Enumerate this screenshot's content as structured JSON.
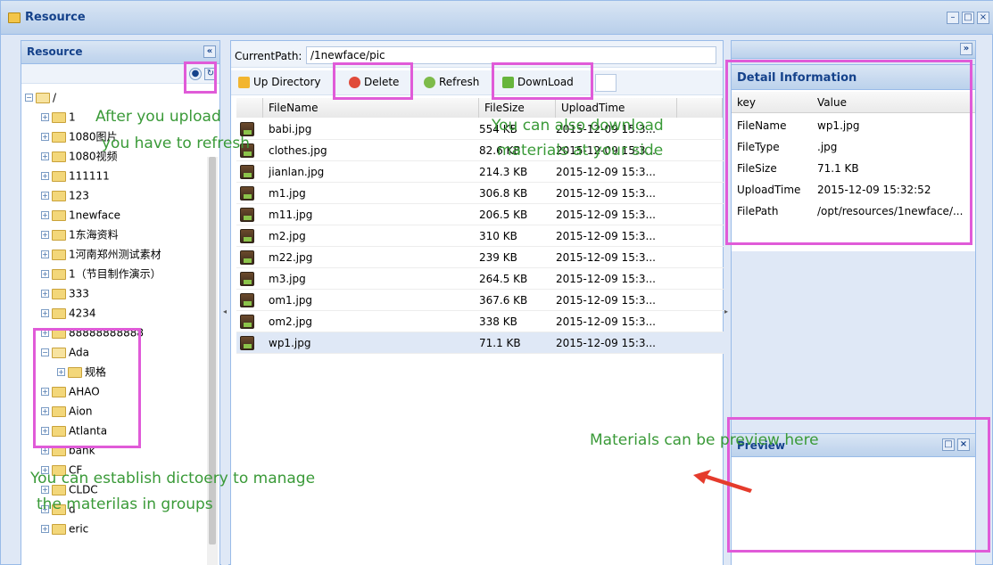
{
  "window": {
    "title": "Resource"
  },
  "left_panel": {
    "title": "Resource",
    "collapse_icon": "«",
    "tree": [
      {
        "label": "/",
        "open": true,
        "level": 0
      },
      {
        "label": "1",
        "open": false,
        "level": 1
      },
      {
        "label": "1080图片",
        "open": false,
        "level": 1
      },
      {
        "label": "1080视频",
        "open": false,
        "level": 1
      },
      {
        "label": "111111",
        "open": false,
        "level": 1
      },
      {
        "label": "123",
        "open": false,
        "level": 1
      },
      {
        "label": "1newface",
        "open": false,
        "level": 1
      },
      {
        "label": "1东海资料",
        "open": false,
        "level": 1
      },
      {
        "label": "1河南郑州测试素材",
        "open": false,
        "level": 1
      },
      {
        "label": "1（节目制作演示）",
        "open": false,
        "level": 1
      },
      {
        "label": "333",
        "open": false,
        "level": 1
      },
      {
        "label": "4234",
        "open": false,
        "level": 1
      },
      {
        "label": "88888888888",
        "open": false,
        "level": 1
      },
      {
        "label": "Ada",
        "open": true,
        "level": 1
      },
      {
        "label": "规格",
        "open": false,
        "level": 2
      },
      {
        "label": "AHAO",
        "open": false,
        "level": 1
      },
      {
        "label": "Aion",
        "open": false,
        "level": 1
      },
      {
        "label": "Atlanta",
        "open": false,
        "level": 1
      },
      {
        "label": "bank",
        "open": false,
        "level": 1
      },
      {
        "label": "CF",
        "open": false,
        "level": 1
      },
      {
        "label": "CLDC",
        "open": false,
        "level": 1
      },
      {
        "label": "d",
        "open": false,
        "level": 1
      },
      {
        "label": "eric",
        "open": false,
        "level": 1
      }
    ]
  },
  "center": {
    "path_label": "CurrentPath:",
    "path_value": "/1newface/pic",
    "toolbar": {
      "up_label": "Up Directory",
      "delete_label": "Delete",
      "refresh_label": "Refresh",
      "download_label": "DownLoad"
    },
    "columns": [
      "FileName",
      "FileSize",
      "UploadTime"
    ],
    "rows": [
      {
        "name": "babi.jpg",
        "size": "554 KB",
        "time": "2015-12-09 15:3..."
      },
      {
        "name": "clothes.jpg",
        "size": "82.6 KB",
        "time": "2015-12-09 15:3..."
      },
      {
        "name": "jianlan.jpg",
        "size": "214.3 KB",
        "time": "2015-12-09 15:3..."
      },
      {
        "name": "m1.jpg",
        "size": "306.8 KB",
        "time": "2015-12-09 15:3..."
      },
      {
        "name": "m11.jpg",
        "size": "206.5 KB",
        "time": "2015-12-09 15:3..."
      },
      {
        "name": "m2.jpg",
        "size": "310 KB",
        "time": "2015-12-09 15:3..."
      },
      {
        "name": "m22.jpg",
        "size": "239 KB",
        "time": "2015-12-09 15:3..."
      },
      {
        "name": "m3.jpg",
        "size": "264.5 KB",
        "time": "2015-12-09 15:3..."
      },
      {
        "name": "om1.jpg",
        "size": "367.6 KB",
        "time": "2015-12-09 15:3..."
      },
      {
        "name": "om2.jpg",
        "size": "338 KB",
        "time": "2015-12-09 15:3..."
      },
      {
        "name": "wp1.jpg",
        "size": "71.1 KB",
        "time": "2015-12-09 15:3...",
        "selected": true
      }
    ]
  },
  "detail": {
    "title": "Detail Information",
    "col_key": "key",
    "col_value": "Value",
    "rows": [
      {
        "k": "FileName",
        "v": "wp1.jpg"
      },
      {
        "k": "FileType",
        "v": ".jpg"
      },
      {
        "k": "FileSize",
        "v": "71.1 KB"
      },
      {
        "k": "UploadTime",
        "v": "2015-12-09 15:32:52"
      },
      {
        "k": "FilePath",
        "v": "/opt/resources/1newface/..."
      }
    ]
  },
  "preview": {
    "title": "Preview"
  },
  "annotations": {
    "upload": "After you upload",
    "refresh": "you have to refresh",
    "download1": "You can also download",
    "download2": "materials at your side",
    "preview": "Materials can be preview here",
    "dir1": "You can establish dictoery to manage",
    "dir2": "the materilas in groups"
  },
  "colors": {
    "accent": "#15428b",
    "highlight": "#e05bd8",
    "annotation": "#3a9a38"
  }
}
